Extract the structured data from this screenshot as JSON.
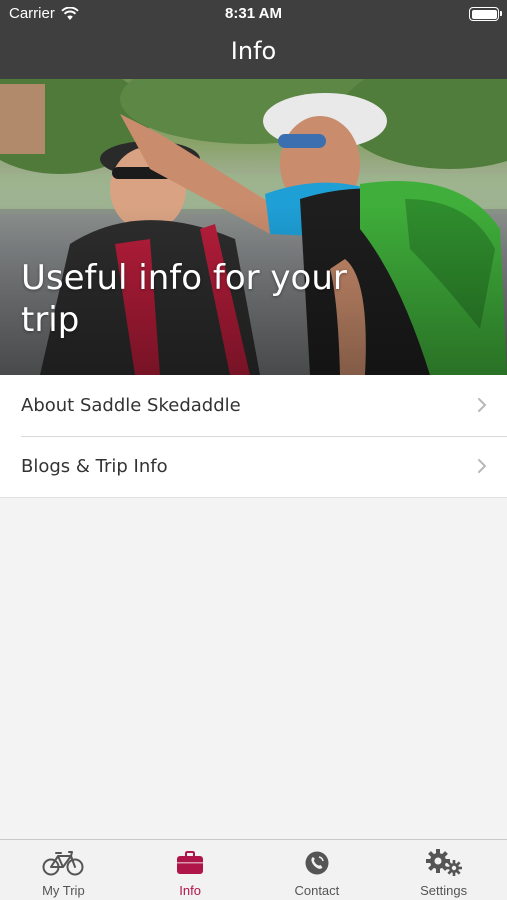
{
  "status_bar": {
    "carrier": "Carrier",
    "time": "8:31 AM"
  },
  "nav": {
    "title": "Info"
  },
  "hero": {
    "title": "Useful info for your trip"
  },
  "menu": {
    "items": [
      {
        "label": "About Saddle Skedaddle",
        "icon": "chevron-right-icon"
      },
      {
        "label": "Blogs & Trip Info",
        "icon": "chevron-right-icon"
      }
    ]
  },
  "tab_bar": {
    "active_color": "#b0154a",
    "tabs": [
      {
        "label": "My Trip",
        "icon": "bicycle-icon",
        "active": false
      },
      {
        "label": "Info",
        "icon": "briefcase-icon",
        "active": true
      },
      {
        "label": "Contact",
        "icon": "phone-icon",
        "active": false
      },
      {
        "label": "Settings",
        "icon": "gears-icon",
        "active": false
      }
    ]
  }
}
